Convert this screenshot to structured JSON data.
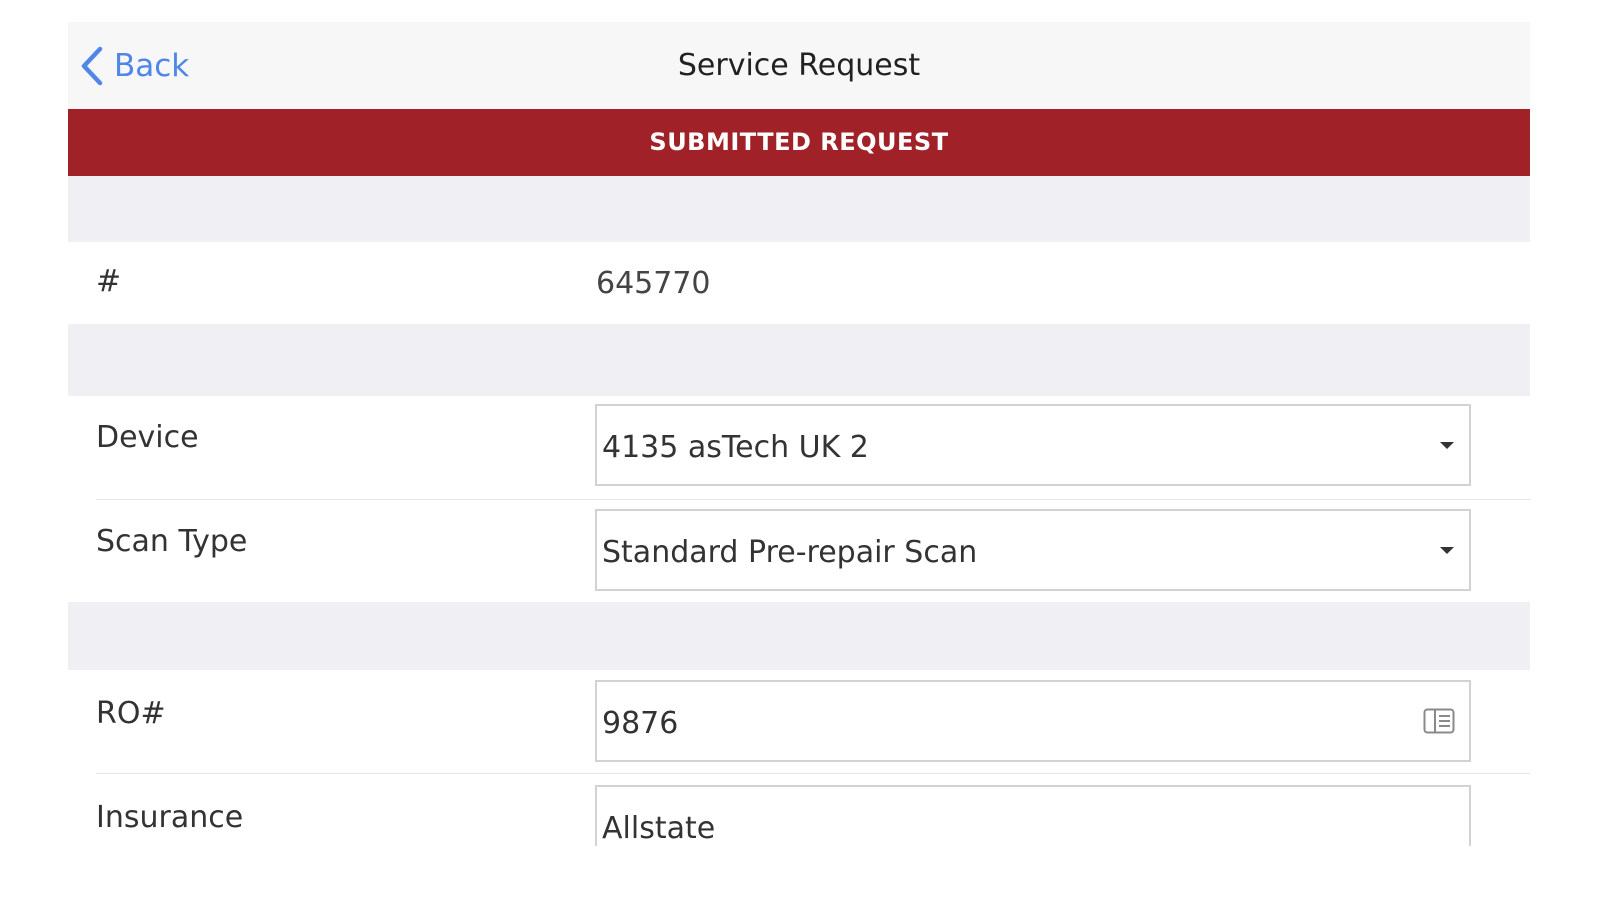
{
  "nav": {
    "back_label": "Back",
    "title": "Service Request"
  },
  "banner": {
    "text": "SUBMITTED REQUEST",
    "color": "#a02228"
  },
  "request": {
    "number_label": "#",
    "number_value": "645770"
  },
  "form": {
    "device": {
      "label": "Device",
      "value": "4135 asTech UK 2"
    },
    "scan_type": {
      "label": "Scan Type",
      "value": "Standard Pre-repair Scan"
    },
    "ro": {
      "label": "RO#",
      "value": "9876"
    },
    "insurance": {
      "label": "Insurance",
      "value": "Allstate"
    }
  },
  "icons": {
    "back": "chevron-left-icon",
    "dropdown": "caret-down-icon",
    "scanner": "barcode-scan-icon"
  },
  "colors": {
    "accent": "#4f86e8",
    "banner": "#a02228",
    "section_bg": "#efeff4"
  }
}
